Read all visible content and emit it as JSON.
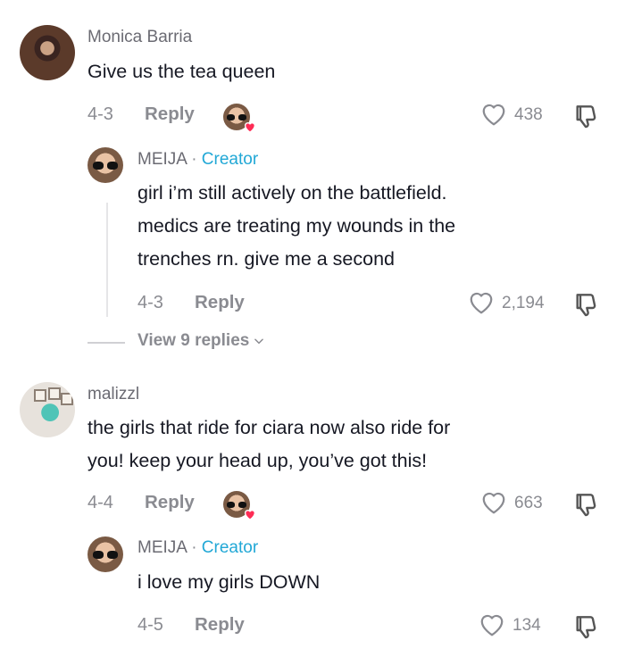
{
  "comments": [
    {
      "user": "Monica Barria",
      "text": "Give us the tea queen",
      "date": "4-3",
      "reply_label": "Reply",
      "likes": "438",
      "reply": {
        "user": "MEIJA",
        "separator": "·",
        "badge": "Creator",
        "text_lines": [
          "girl i’m still actively on the battlefield.",
          "medics are treating my wounds in the",
          "trenches rn. give me a second"
        ],
        "date": "4-3",
        "reply_label": "Reply",
        "likes": "2,194"
      },
      "view_replies": "View 9 replies"
    },
    {
      "user": "malizzl",
      "text_lines": [
        "the girls that ride for ciara now also ride for",
        "you! keep your head up, you’ve got this!"
      ],
      "date": "4-4",
      "reply_label": "Reply",
      "likes": "663",
      "reply": {
        "user": "MEIJA",
        "separator": "·",
        "badge": "Creator",
        "text": "i love my girls DOWN",
        "date": "4-5",
        "reply_label": "Reply",
        "likes": "134"
      }
    }
  ],
  "icons": {
    "like": "heart-outline-icon",
    "dislike": "thumbs-down-icon",
    "creator_liked": "creator-liked-heart-icon",
    "expand": "chevron-down-icon"
  },
  "colors": {
    "creator_badge": "#22a8d6",
    "liked_heart": "#fe2c55",
    "muted": "#8a8b91"
  }
}
